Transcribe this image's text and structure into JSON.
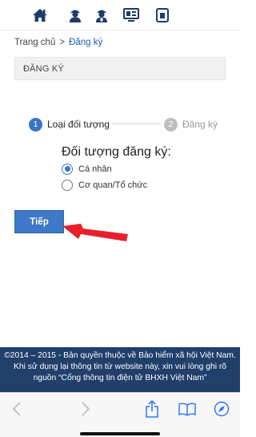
{
  "breadcrumb": {
    "home": "Trang chủ",
    "separator": ">",
    "current": "Đăng ký"
  },
  "page_heading": "ĐĂNG KÝ",
  "steps": [
    {
      "number": "1",
      "label": "Loại đối tượng",
      "state": "active"
    },
    {
      "number": "2",
      "label": "Đăng ký",
      "state": "inactive"
    }
  ],
  "form": {
    "group_title": "Đối tượng đăng ký:",
    "options": [
      {
        "label": "Cá nhân",
        "checked": true
      },
      {
        "label": "Cơ quan/Tổ chức",
        "checked": false
      }
    ],
    "next_button": "Tiếp"
  },
  "footer": {
    "line1": "©2014 – 2015 - Bản quyền thuộc về Bảo hiểm xã hội Việt Nam.",
    "line2": "Khi sử dụng lại thông tin từ website này, xin vui lòng ghi rõ",
    "line3": "nguồn “Cổng thông tin điện tử BHXH Việt Nam”"
  },
  "colors": {
    "accent": "#3a76c4",
    "nav_icon": "#1f3c68",
    "footer_bg": "#213f6b",
    "annotation_arrow": "#e8202a"
  },
  "icons": {
    "top_nav": [
      "home-icon",
      "person-icon",
      "person-group-icon",
      "monitor-icon",
      "document-icon"
    ],
    "toolbar": [
      "back-arrow-icon",
      "forward-arrow-icon",
      "share-icon",
      "bookmarks-icon",
      "compass-icon"
    ]
  }
}
